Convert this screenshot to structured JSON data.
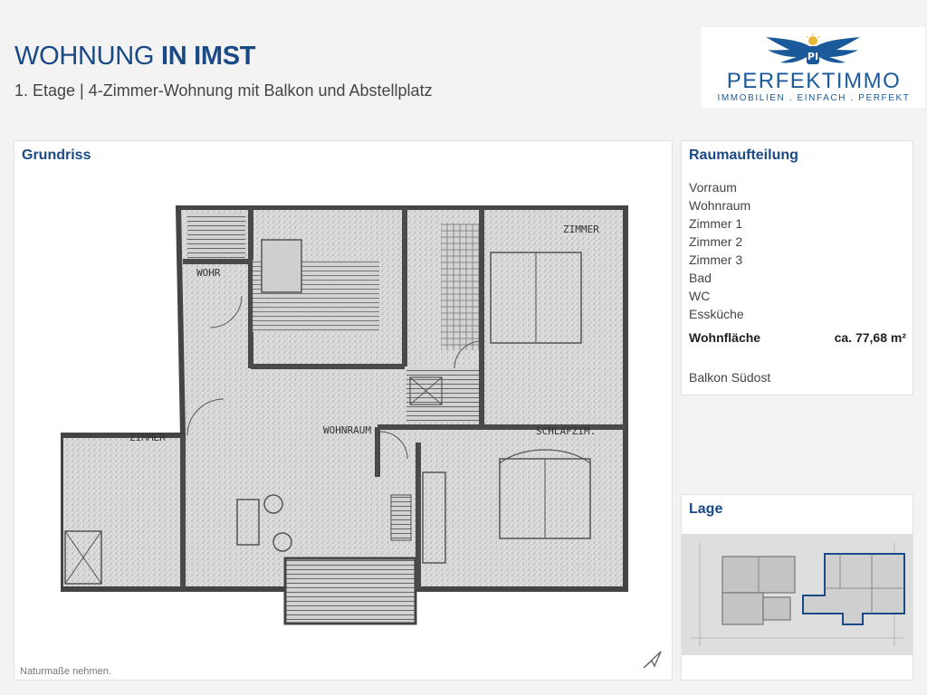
{
  "header": {
    "title_light": "WOHNUNG",
    "title_bold": "IN IMST",
    "subtitle": "1. Etage | 4-Zimmer-Wohnung mit Balkon und Abstellplatz"
  },
  "logo": {
    "name": "PERFEKTIMMO",
    "tagline": "IMMOBILIEN . EINFACH . PERFEKT",
    "emblem": "wings-logo-icon"
  },
  "grundriss": {
    "title": "Grundriss",
    "note": "Naturmaße nehmen.",
    "plan_labels": [
      "WOHNRAUM",
      "ZIMMER",
      "ZIMMER",
      "SCHLAFZIM.",
      "WOHR"
    ],
    "north_icon": "north-arrow-icon"
  },
  "raumaufteilung": {
    "title": "Raumaufteilung",
    "rooms": [
      "Vorraum",
      "Wohnraum",
      "Zimmer 1",
      "Zimmer 2",
      "Zimmer 3",
      "Bad",
      "WC",
      "Essküche"
    ],
    "wohnflaeche_label": "Wohnfläche",
    "wohnflaeche_value": "ca. 77,68 m²",
    "balkon": "Balkon Südost"
  },
  "lage": {
    "title": "Lage"
  },
  "colors": {
    "brand_blue": "#1a4a86",
    "logo_blue": "#1a5a9a",
    "logo_gold": "#e8b838"
  }
}
